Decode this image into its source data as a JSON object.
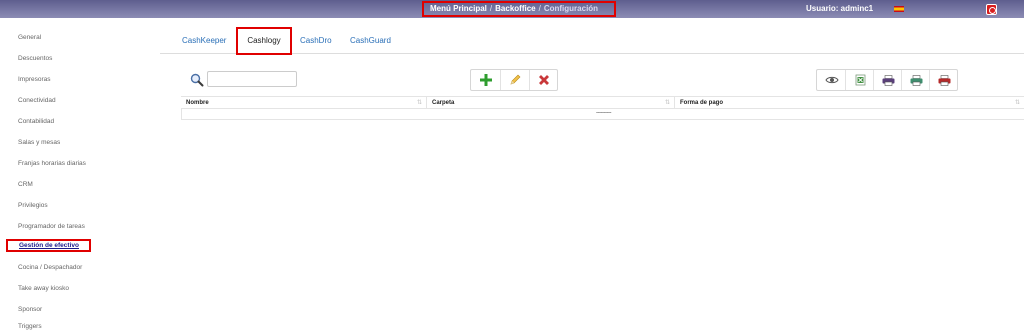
{
  "header": {
    "breadcrumbs": [
      "Menú Principal",
      "Backoffice",
      "Configuración"
    ],
    "separator": "/",
    "user_label": "Usuario: adminc1",
    "flag_icon": "spain-flag-icon",
    "power_icon": "power-icon"
  },
  "sidebar": {
    "items": [
      {
        "label": "General"
      },
      {
        "label": "Descuentos"
      },
      {
        "label": "Impresoras"
      },
      {
        "label": "Conectividad"
      },
      {
        "label": "Contabilidad"
      },
      {
        "label": "Salas y mesas"
      },
      {
        "label": "Franjas horarias diarias"
      },
      {
        "label": "CRM"
      },
      {
        "label": "Privilegios"
      },
      {
        "label": "Programador de tareas"
      },
      {
        "label": "Gestión de efectivo",
        "active": true
      },
      {
        "label": "Cocina / Despachador"
      },
      {
        "label": "Take away kiosko"
      },
      {
        "label": "Sponsor"
      },
      {
        "label": "Triggers"
      }
    ]
  },
  "tabs": [
    {
      "label": "CashKeeper"
    },
    {
      "label": "Cashlogy",
      "active": true
    },
    {
      "label": "CashDro"
    },
    {
      "label": "CashGuard"
    }
  ],
  "toolbar": {
    "search_placeholder": "",
    "search_value": "",
    "actions": [
      "add-icon",
      "edit-icon",
      "delete-icon"
    ],
    "view_actions": [
      "view-icon",
      "excel-export-icon",
      "print-icon",
      "print-preview-icon",
      "pdf-export-icon"
    ]
  },
  "table": {
    "columns": [
      "Nombre",
      "Carpeta",
      "Forma de pago"
    ],
    "sort_glyph": "⇅",
    "empty_text": "----------"
  },
  "colors": {
    "topbar": "#6e6e9a",
    "highlight": "#e00000",
    "link": "#2a6fb7",
    "active_link": "#1a1a8c"
  }
}
